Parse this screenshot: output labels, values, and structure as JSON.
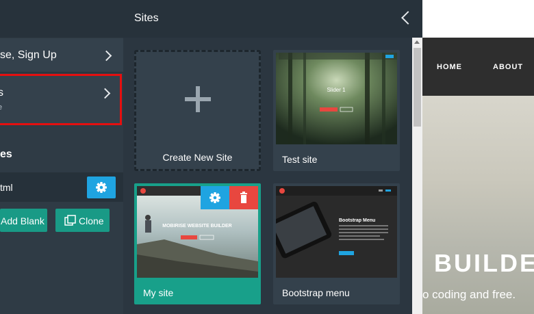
{
  "left_panel": {
    "signup_label": "se, Sign Up",
    "sites_title": "s",
    "sites_subtitle": "e",
    "pages_title": "es",
    "page_name": "tml",
    "add_blank_label": "Add Blank",
    "clone_label": "Clone"
  },
  "sites_panel": {
    "title": "Sites",
    "cards": [
      {
        "name": "Create New Site"
      },
      {
        "name": "Test site",
        "thumb_title": "Slider 1"
      },
      {
        "name": "My site",
        "thumb_title": "MOBIRISE WEBSITE BUILDER"
      },
      {
        "name": "Bootstrap menu",
        "thumb_title": "Bootstrap Menu"
      }
    ]
  },
  "preview": {
    "nav_links": [
      "HOME",
      "ABOUT"
    ],
    "headline": "BUILDE",
    "subline": "o coding and free."
  },
  "colors": {
    "accent_blue": "#1fa4e1",
    "accent_green": "#18a08a",
    "delete_red": "#e8473f",
    "highlight_red": "#e60f0f"
  }
}
